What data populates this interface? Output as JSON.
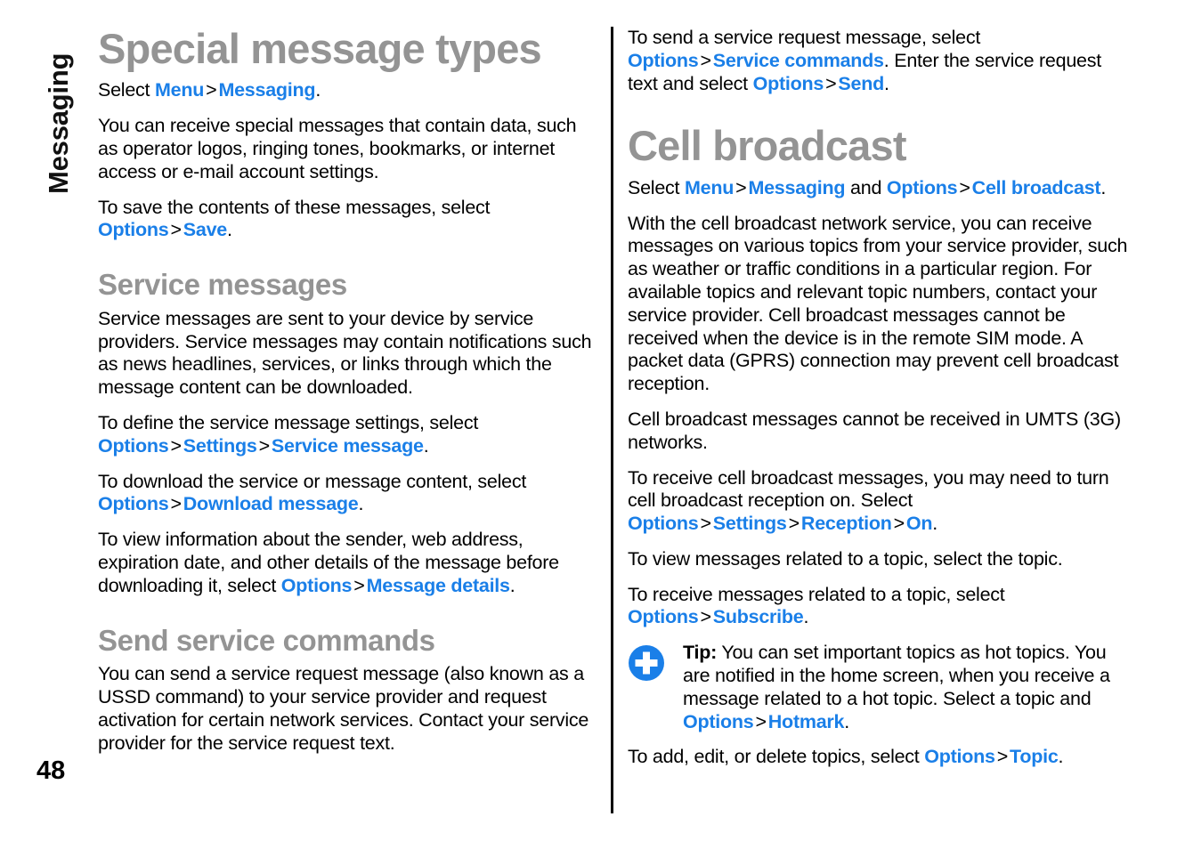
{
  "document": {
    "chapter_tab": "Messaging",
    "page_number": "48",
    "accent_link_color": "#1a7fe8",
    "heading_color": "#949494",
    "body_color": "#000000"
  },
  "left_column": {
    "title": "Special message types",
    "blocks": [
      {
        "id": "select-menu-messaging",
        "runs": [
          {
            "t": "text",
            "v": "Select "
          },
          {
            "t": "link",
            "v": "Menu"
          },
          {
            "t": "sep",
            "v": ">"
          },
          {
            "t": "link",
            "v": "Messaging"
          },
          {
            "t": "text",
            "v": "."
          }
        ]
      },
      {
        "id": "receive-special-messages",
        "runs": [
          {
            "t": "text",
            "v": "You can receive special messages that contain data, such as operator logos, ringing tones, bookmarks, or internet access or e-mail account settings."
          }
        ]
      },
      {
        "id": "save-contents",
        "runs": [
          {
            "t": "text",
            "v": "To save the contents of these messages, select "
          },
          {
            "t": "link",
            "v": "Options"
          },
          {
            "t": "sep",
            "v": ">"
          },
          {
            "t": "link",
            "v": "Save"
          },
          {
            "t": "text",
            "v": "."
          }
        ]
      }
    ],
    "section_service_messages": {
      "heading": "Service messages",
      "blocks": [
        {
          "id": "service-messages-intro",
          "runs": [
            {
              "t": "text",
              "v": "Service messages are sent to your device by service providers. Service messages may contain notifications such as news headlines, services, or links through which the message content can be downloaded."
            }
          ]
        },
        {
          "id": "define-service-settings",
          "runs": [
            {
              "t": "text",
              "v": "To define the service message settings, select "
            },
            {
              "t": "link",
              "v": "Options"
            },
            {
              "t": "sep",
              "v": ">"
            },
            {
              "t": "link",
              "v": "Settings"
            },
            {
              "t": "sep",
              "v": ">"
            },
            {
              "t": "link",
              "v": "Service message"
            },
            {
              "t": "text",
              "v": "."
            }
          ]
        },
        {
          "id": "download-service-content",
          "runs": [
            {
              "t": "text",
              "v": "To download the service or message content, select "
            },
            {
              "t": "link",
              "v": "Options"
            },
            {
              "t": "sep",
              "v": ">"
            },
            {
              "t": "link",
              "v": "Download message"
            },
            {
              "t": "text",
              "v": "."
            }
          ]
        },
        {
          "id": "view-sender-info",
          "runs": [
            {
              "t": "text",
              "v": "To view information about the sender, web address, expiration date, and other details of the message before downloading it, select "
            },
            {
              "t": "link",
              "v": "Options"
            },
            {
              "t": "sep",
              "v": ">"
            },
            {
              "t": "link",
              "v": "Message details"
            },
            {
              "t": "text",
              "v": "."
            }
          ]
        }
      ]
    },
    "section_send_service_commands": {
      "heading": "Send service commands",
      "blocks": [
        {
          "id": "ussd-intro",
          "runs": [
            {
              "t": "text",
              "v": "You can send a service request message (also known as a USSD command) to your service provider and request activation for certain network services. Contact your service provider for the service request text."
            }
          ]
        }
      ]
    }
  },
  "right_column": {
    "blocks_top": [
      {
        "id": "send-service-request",
        "runs": [
          {
            "t": "text",
            "v": "To send a service request message, select "
          },
          {
            "t": "link",
            "v": "Options"
          },
          {
            "t": "sep",
            "v": ">"
          },
          {
            "t": "link",
            "v": "Service commands"
          },
          {
            "t": "text",
            "v": ". Enter the service request text and select "
          },
          {
            "t": "link",
            "v": "Options"
          },
          {
            "t": "sep",
            "v": ">"
          },
          {
            "t": "link",
            "v": "Send"
          },
          {
            "t": "text",
            "v": "."
          }
        ]
      }
    ],
    "title": "Cell broadcast",
    "blocks": [
      {
        "id": "select-cell-broadcast",
        "runs": [
          {
            "t": "text",
            "v": "Select "
          },
          {
            "t": "link",
            "v": "Menu"
          },
          {
            "t": "sep",
            "v": ">"
          },
          {
            "t": "link",
            "v": "Messaging"
          },
          {
            "t": "text",
            "v": " and "
          },
          {
            "t": "link",
            "v": "Options"
          },
          {
            "t": "sep",
            "v": ">"
          },
          {
            "t": "link",
            "v": "Cell broadcast"
          },
          {
            "t": "text",
            "v": "."
          }
        ]
      },
      {
        "id": "cell-broadcast-intro",
        "runs": [
          {
            "t": "text",
            "v": "With the cell broadcast network service, you can receive messages on various topics from your service provider, such as weather or traffic conditions in a particular region. For available topics and relevant topic numbers, contact your service provider. Cell broadcast messages cannot be received when the device is in the remote SIM mode. A packet data (GPRS) connection may prevent cell broadcast reception."
          }
        ]
      },
      {
        "id": "umts-note",
        "runs": [
          {
            "t": "text",
            "v": "Cell broadcast messages cannot be received in UMTS (3G) networks."
          }
        ]
      },
      {
        "id": "turn-reception-on",
        "runs": [
          {
            "t": "text",
            "v": "To receive cell broadcast messages, you may need to turn cell broadcast reception on. Select "
          },
          {
            "t": "link",
            "v": "Options"
          },
          {
            "t": "sep",
            "v": ">"
          },
          {
            "t": "link",
            "v": "Settings"
          },
          {
            "t": "sep",
            "v": ">"
          },
          {
            "t": "link",
            "v": "Reception"
          },
          {
            "t": "sep",
            "v": ">"
          },
          {
            "t": "link",
            "v": "On"
          },
          {
            "t": "text",
            "v": "."
          }
        ]
      },
      {
        "id": "view-topic-messages",
        "runs": [
          {
            "t": "text",
            "v": "To view messages related to a topic, select the topic."
          }
        ]
      },
      {
        "id": "subscribe-topic",
        "runs": [
          {
            "t": "text",
            "v": "To receive messages related to a topic, select "
          },
          {
            "t": "link",
            "v": "Options"
          },
          {
            "t": "sep",
            "v": ">"
          },
          {
            "t": "link",
            "v": "Subscribe"
          },
          {
            "t": "text",
            "v": "."
          }
        ]
      }
    ],
    "tip": {
      "icon": "tip-plus-icon",
      "icon_color": "#1a7fe8",
      "label": "Tip:",
      "runs": [
        {
          "t": "text",
          "v": " You can set important topics as hot topics. You are notified in the home screen, when you receive a message related to a hot topic. Select a topic and "
        },
        {
          "t": "link",
          "v": "Options"
        },
        {
          "t": "sep",
          "v": ">"
        },
        {
          "t": "link",
          "v": "Hotmark"
        },
        {
          "t": "text",
          "v": "."
        }
      ]
    },
    "blocks_after_tip": [
      {
        "id": "add-edit-delete-topics",
        "runs": [
          {
            "t": "text",
            "v": "To add, edit, or delete topics, select "
          },
          {
            "t": "link",
            "v": "Options"
          },
          {
            "t": "sep",
            "v": ">"
          },
          {
            "t": "link",
            "v": "Topic"
          },
          {
            "t": "text",
            "v": "."
          }
        ]
      }
    ]
  }
}
